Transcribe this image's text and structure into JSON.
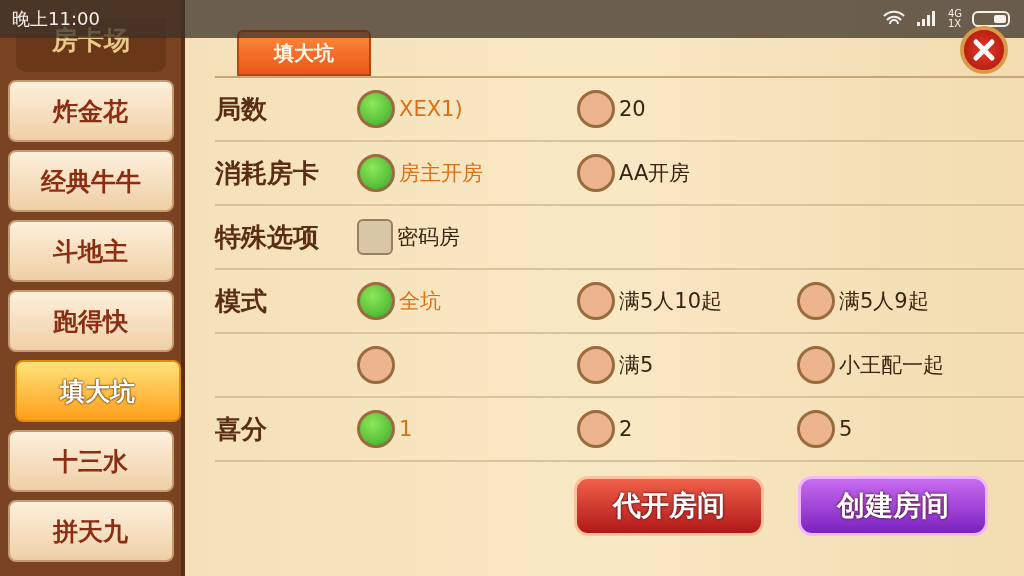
{
  "status_bar": {
    "time": "晚上11:00",
    "network": [
      "4G",
      "1X"
    ]
  },
  "sidebar": {
    "title": "房卡场",
    "items": [
      {
        "label": "炸金花",
        "selected": false
      },
      {
        "label": "经典牛牛",
        "selected": false
      },
      {
        "label": "斗地主",
        "selected": false
      },
      {
        "label": "跑得快",
        "selected": false
      },
      {
        "label": "填大坑",
        "selected": true
      },
      {
        "label": "十三水",
        "selected": false
      },
      {
        "label": "拼天九",
        "selected": false
      }
    ]
  },
  "tabs": [
    {
      "label": "填大坑",
      "selected": true
    }
  ],
  "options": [
    {
      "label": "局数",
      "rows": [
        [
          {
            "kind": "radio",
            "label": "XEX1)",
            "selected": true
          },
          {
            "kind": "radio",
            "label": "20",
            "selected": false
          }
        ]
      ]
    },
    {
      "label": "消耗房卡",
      "rows": [
        [
          {
            "kind": "radio",
            "label": "房主开房",
            "selected": true
          },
          {
            "kind": "radio",
            "label": "AA开房",
            "selected": false
          }
        ]
      ]
    },
    {
      "label": "特殊选项",
      "rows": [
        [
          {
            "kind": "checkbox",
            "label": "密码房",
            "checked": false
          }
        ]
      ]
    },
    {
      "label": "模式",
      "rows": [
        [
          {
            "kind": "radio",
            "label": "全坑",
            "selected": true
          },
          {
            "kind": "radio",
            "label": "满5人10起",
            "selected": false
          },
          {
            "kind": "radio",
            "label": "满5人9起",
            "selected": false
          }
        ],
        [
          {
            "kind": "radio",
            "selected": false
          },
          {
            "kind": "radio",
            "label": "满5",
            "selected": false
          },
          {
            "kind": "radio",
            "label": "小王配一起",
            "selected": false
          }
        ]
      ]
    },
    {
      "label": "喜分",
      "rows": [
        [
          {
            "kind": "radio",
            "label": "1",
            "selected": true
          },
          {
            "kind": "radio",
            "label": "2",
            "selected": false
          },
          {
            "kind": "radio",
            "label": "5",
            "selected": false
          }
        ]
      ]
    }
  ],
  "buttons": [
    {
      "label": "代开房间",
      "kind": "secondary"
    },
    {
      "label": "创建房间",
      "kind": "primary"
    }
  ]
}
